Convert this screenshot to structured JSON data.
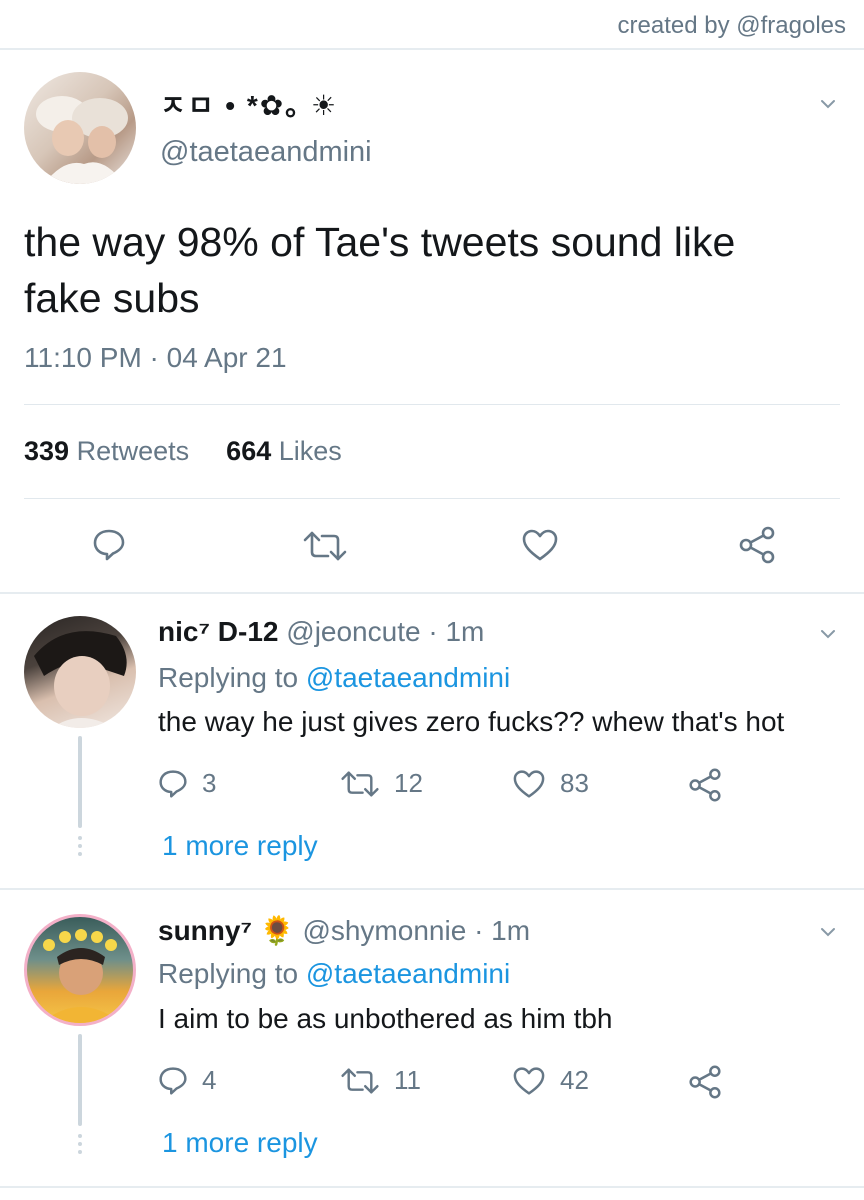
{
  "header": {
    "credit": "created by @fragoles"
  },
  "tweet": {
    "display_name": "ㅈㅁ • *✿｡ ☀",
    "handle": "@taetaeandmini",
    "text": "the way 98% of Tae's tweets sound like fake subs",
    "timestamp": "11:10 PM · 04 Apr 21",
    "retweets_count": "339",
    "retweets_label": "Retweets",
    "likes_count": "664",
    "likes_label": "Likes"
  },
  "replies": [
    {
      "display_name": "nic⁷ D-12",
      "handle": "@jeoncute",
      "time": "· 1m",
      "replying_prefix": "Replying to",
      "replying_handle": "@taetaeandmini",
      "text": "the way he just gives zero fucks?? whew that's hot",
      "reply_count": "3",
      "retweet_count": "12",
      "like_count": "83",
      "more_replies": "1 more reply"
    },
    {
      "display_name": "sunny⁷ 🌻",
      "handle": "@shymonnie",
      "time": "· 1m",
      "replying_prefix": "Replying to",
      "replying_handle": "@taetaeandmini",
      "text": "I aim to be as unbothered as him tbh",
      "reply_count": "4",
      "retweet_count": "11",
      "like_count": "42",
      "more_replies": "1 more reply"
    }
  ],
  "icons": {
    "reply": "reply-icon",
    "retweet": "retweet-icon",
    "like": "heart-icon",
    "share": "share-icon",
    "chevron": "chevron-down-icon"
  },
  "colors": {
    "accent": "#1b95e0",
    "secondary_text": "#657786",
    "primary_text": "#14171a",
    "divider": "#e6ecf0"
  }
}
